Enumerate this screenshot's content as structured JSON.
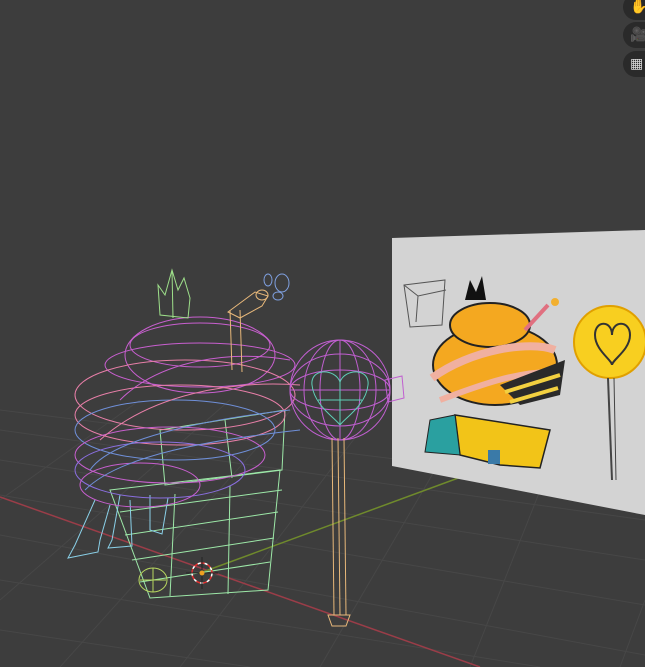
{
  "viewport": {
    "background": "#3d3d3d",
    "grid_color": "#474747",
    "x_axis_color": "#9a3d48",
    "y_axis_color": "#6f8a2c"
  },
  "navigation_gizmos": [
    {
      "name": "hand-icon",
      "glyph": "✋"
    },
    {
      "name": "camera-icon",
      "glyph": "🎥"
    },
    {
      "name": "grid-view-icon",
      "glyph": "▦"
    }
  ],
  "reference_image": {
    "background": "#d3d3d3"
  },
  "wireframe_colors": {
    "frosting": "#c85fcf",
    "frosting_pink": "#e87fa8",
    "swirl_blue": "#6f8fd8",
    "cup": "#9de8a8",
    "legs": "#8ad0e8",
    "crown": "#9ee08a",
    "straw": "#e8b87a",
    "lollipop_head": "#c05fd0",
    "lollipop_heart": "#5fd0b8",
    "lollipop_stick": "#e8b87a"
  }
}
